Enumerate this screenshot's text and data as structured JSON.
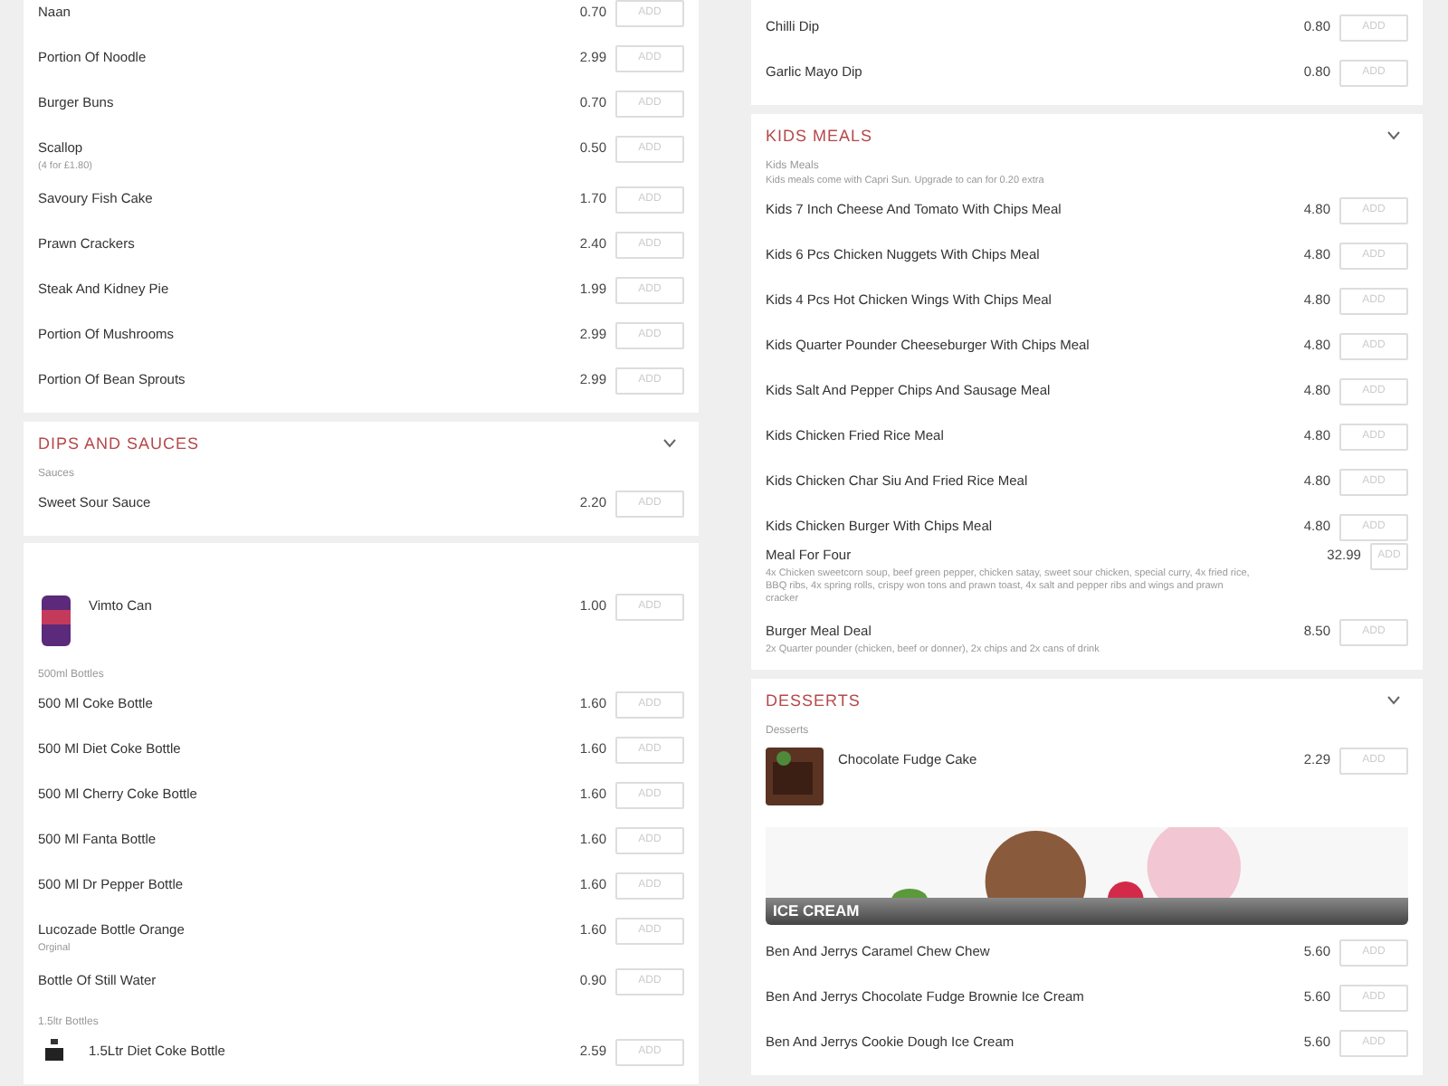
{
  "panels": [
    {
      "cards": [
        {
          "entries": [
            {
              "kind": "item",
              "name": "Naan",
              "price": "0.70",
              "button": "ADD"
            },
            {
              "kind": "item",
              "name": "Portion Of Noodle",
              "price": "2.99",
              "button": "ADD"
            },
            {
              "kind": "item",
              "name": "Burger Buns",
              "price": "0.70",
              "button": "ADD"
            },
            {
              "kind": "item",
              "name": "Scallop",
              "note": "(4 for £1.80)",
              "price": "0.50",
              "button": "ADD"
            },
            {
              "kind": "item",
              "name": "Savoury Fish Cake",
              "price": "1.70",
              "button": "ADD"
            },
            {
              "kind": "item",
              "name": "Prawn Crackers",
              "price": "2.40",
              "button": "ADD"
            },
            {
              "kind": "item",
              "name": "Steak And Kidney Pie",
              "price": "1.99",
              "button": "ADD"
            },
            {
              "kind": "item",
              "name": "Portion Of Mushrooms",
              "price": "2.99",
              "button": "ADD"
            },
            {
              "kind": "item",
              "name": "Portion Of Bean Sprouts",
              "price": "2.99",
              "button": "ADD"
            }
          ]
        },
        {
          "header": {
            "title": "DIPS AND SAUCES"
          },
          "entries": [
            {
              "kind": "group_label",
              "text": "Sauces"
            },
            {
              "kind": "item",
              "name": "Sweet Sour Sauce",
              "price": "2.20",
              "button": "ADD"
            }
          ]
        }
      ]
    },
    {
      "cards": [
        {
          "entries": [
            {
              "kind": "item",
              "name": "Chilli Dip",
              "price": "0.80",
              "button": "ADD"
            },
            {
              "kind": "item",
              "name": "Garlic Mayo Dip",
              "price": "0.80",
              "button": "ADD"
            }
          ]
        },
        {
          "header": {
            "title": "KIDS MEALS"
          },
          "entries": [
            {
              "kind": "group_label",
              "text": "Kids Meals",
              "note": "Kids meals come with Capri Sun. Upgrade to can for 0.20 extra"
            },
            {
              "kind": "item",
              "name": "Kids 7 Inch Cheese And Tomato With Chips Meal",
              "price": "4.80",
              "button": "ADD"
            },
            {
              "kind": "item",
              "name": "Kids 6 Pcs Chicken Nuggets With Chips Meal",
              "price": "4.80",
              "button": "ADD"
            },
            {
              "kind": "item",
              "name": "Kids 4 Pcs Hot Chicken Wings With Chips Meal",
              "price": "4.80",
              "button": "ADD"
            },
            {
              "kind": "item",
              "name": "Kids Quarter Pounder Cheeseburger With Chips Meal",
              "price": "4.80",
              "button": "ADD"
            },
            {
              "kind": "item",
              "name": "Kids Salt And Pepper Chips And Sausage Meal",
              "price": "4.80",
              "button": "ADD"
            },
            {
              "kind": "item",
              "name": "Kids Chicken Fried Rice Meal",
              "price": "4.80",
              "button": "ADD"
            },
            {
              "kind": "item",
              "name": "Kids Chicken Char Siu And Fried Rice Meal",
              "price": "4.80",
              "button": "ADD"
            },
            {
              "kind": "item",
              "name": "Kids Chicken Burger With Chips Meal",
              "price": "4.80",
              "button": "ADD"
            }
          ]
        }
      ]
    },
    {
      "cards": [
        {
          "entries": [
            {
              "kind": "can_item",
              "name": "Vimto Can",
              "price": "1.00",
              "button": "ADD"
            },
            {
              "kind": "group_label",
              "text": "500ml Bottles"
            },
            {
              "kind": "item",
              "name": "500 Ml Coke Bottle",
              "price": "1.60",
              "button": "ADD"
            },
            {
              "kind": "item",
              "name": "500 Ml Diet Coke Bottle",
              "price": "1.60",
              "button": "ADD"
            },
            {
              "kind": "item",
              "name": "500 Ml Cherry Coke Bottle",
              "price": "1.60",
              "button": "ADD"
            },
            {
              "kind": "item",
              "name": "500 Ml Fanta Bottle",
              "price": "1.60",
              "button": "ADD"
            },
            {
              "kind": "item",
              "name": "500 Ml Dr Pepper Bottle",
              "price": "1.60",
              "button": "ADD"
            },
            {
              "kind": "item",
              "name": "Lucozade Bottle Orange",
              "note": "Orginal",
              "price": "1.60",
              "button": "ADD"
            },
            {
              "kind": "item",
              "name": "Bottle Of Still Water",
              "price": "0.90",
              "button": "ADD"
            },
            {
              "kind": "group_label",
              "text": "1.5ltr Bottles"
            },
            {
              "kind": "bottle_item",
              "name": "1.5Ltr Diet Coke Bottle",
              "price": "2.59",
              "button": "ADD"
            }
          ]
        }
      ]
    },
    {
      "cards": [
        {
          "entries": [
            {
              "kind": "item",
              "name": "Meal For Four",
              "note": "4x Chicken sweetcorn soup, beef green pepper, chicken satay, sweet sour chicken, special curry, 4x fried rice, BBQ ribs, 4x spring rolls, crispy won tons and prawn toast, 4x salt and pepper ribs and wings and prawn cracker",
              "price": "32.99",
              "button": "ADD"
            },
            {
              "kind": "item",
              "name": "Burger Meal Deal",
              "note": "2x Quarter pounder (chicken, beef or donner), 2x chips and 2x cans of drink",
              "price": "8.50",
              "button": "ADD"
            }
          ]
        },
        {
          "header": {
            "title": "DESSERTS"
          },
          "entries": [
            {
              "kind": "group_label",
              "text": "Desserts"
            },
            {
              "kind": "cake_item",
              "name": "Chocolate Fudge Cake",
              "price": "2.29",
              "button": "ADD"
            },
            {
              "kind": "banner",
              "label": "ICE CREAM"
            },
            {
              "kind": "item",
              "name": "Ben And Jerrys Caramel Chew Chew",
              "price": "5.60",
              "button": "ADD"
            },
            {
              "kind": "item",
              "name": "Ben And Jerrys Chocolate Fudge Brownie Ice Cream",
              "price": "5.60",
              "button": "ADD"
            },
            {
              "kind": "item",
              "name": "Ben And Jerrys Cookie Dough Ice Cream",
              "price": "5.60",
              "button": "ADD"
            }
          ]
        }
      ]
    }
  ]
}
